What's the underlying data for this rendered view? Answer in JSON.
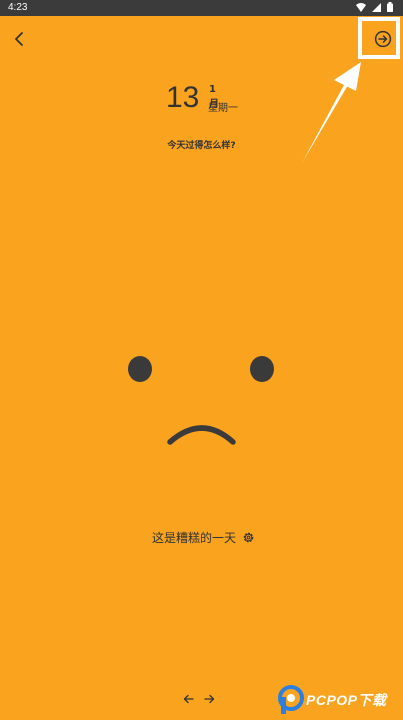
{
  "status_bar": {
    "time": "4:23",
    "icons": [
      "wifi-icon",
      "signal-icon",
      "battery-icon"
    ]
  },
  "toolbar": {
    "back_icon": "chevron-left-icon",
    "next_icon": "arrow-right-circle-icon"
  },
  "date": {
    "day": "13",
    "month": "1月",
    "weekday": "星期一"
  },
  "prompt": "今天过得怎么样?",
  "mood": {
    "face": "sad-face",
    "caption": "这是糟糕的一天",
    "settings_icon": "gear-icon"
  },
  "pager": {
    "prev_icon": "arrow-left-icon",
    "next_icon": "arrow-right-icon"
  },
  "watermark": {
    "text": "PCPOP下载"
  },
  "colors": {
    "background": "#F9A31F",
    "foreground": "#333333",
    "annotation": "#FFFFFF",
    "status_bar": "#3B3B3B"
  }
}
